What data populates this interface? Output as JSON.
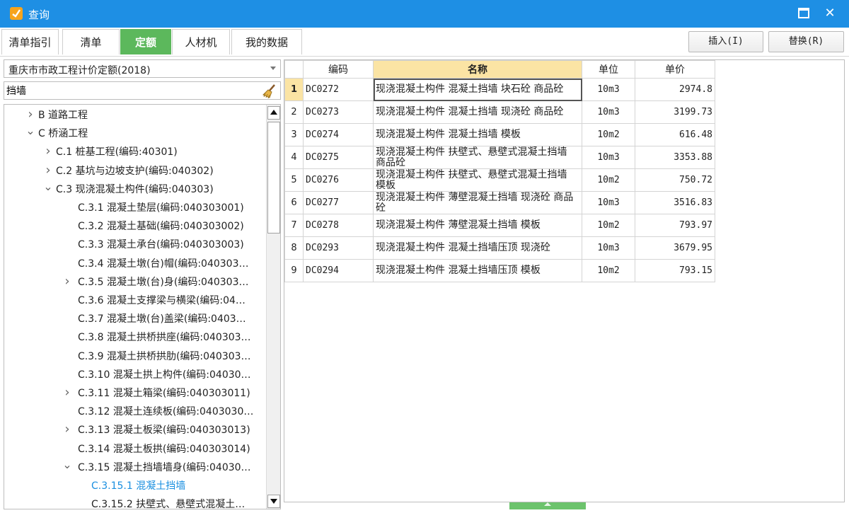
{
  "window": {
    "title": "查询",
    "accent_color": "#1e8fe4",
    "icons": [
      "app-logo-icon",
      "maximize-icon",
      "close-icon"
    ]
  },
  "tabs": [
    {
      "label": "清单指引",
      "active": false
    },
    {
      "label": "清单",
      "active": false
    },
    {
      "label": "定额",
      "active": true
    },
    {
      "label": "人材机",
      "active": false
    },
    {
      "label": "我的数据",
      "active": false
    }
  ],
  "actions": {
    "insert": "插入(I)",
    "replace": "替换(R)"
  },
  "left": {
    "library": "重庆市市政工程计价定额(2018)",
    "search_value": "挡墙",
    "search_icon": "broom-icon",
    "tree": [
      {
        "chevron": "collapsed",
        "label": "B 道路工程"
      },
      {
        "chevron": "expanded",
        "label": "C 桥涵工程"
      },
      {
        "chevron": "collapsed",
        "label": "C.1 桩基工程(编码:40301)"
      },
      {
        "chevron": "collapsed",
        "label": "C.2 基坑与边坡支护(编码:040302)"
      },
      {
        "chevron": "expanded",
        "label": "C.3 现浇混凝土构件(编码:040303)"
      },
      {
        "chevron": "",
        "label": "C.3.1 混凝土垫层(编码:040303001)"
      },
      {
        "chevron": "",
        "label": "C.3.2 混凝土基础(编码:040303002)"
      },
      {
        "chevron": "",
        "label": "C.3.3 混凝土承台(编码:040303003)"
      },
      {
        "chevron": "",
        "label": "C.3.4 混凝土墩(台)帽(编码:040303…"
      },
      {
        "chevron": "collapsed",
        "label": "C.3.5 混凝土墩(台)身(编码:040303…"
      },
      {
        "chevron": "",
        "label": "C.3.6 混凝土支撑梁与横梁(编码:04…"
      },
      {
        "chevron": "",
        "label": "C.3.7 混凝土墩(台)盖梁(编码:0403…"
      },
      {
        "chevron": "",
        "label": "C.3.8 混凝土拱桥拱座(编码:040303…"
      },
      {
        "chevron": "",
        "label": "C.3.9 混凝土拱桥拱肋(编码:040303…"
      },
      {
        "chevron": "",
        "label": "C.3.10 混凝土拱上构件(编码:04030…"
      },
      {
        "chevron": "collapsed",
        "label": "C.3.11 混凝土箱梁(编码:040303011)"
      },
      {
        "chevron": "",
        "label": "C.3.12 混凝土连续板(编码:0403030…"
      },
      {
        "chevron": "collapsed",
        "label": "C.3.13 混凝土板梁(编码:040303013)"
      },
      {
        "chevron": "",
        "label": "C.3.14 混凝土板拱(编码:040303014)"
      },
      {
        "chevron": "expanded",
        "label": "C.3.15 混凝土挡墙墙身(编码:04030…"
      },
      {
        "chevron": "",
        "label": "C.3.15.1 混凝土挡墙",
        "selected": true
      },
      {
        "chevron": "",
        "label": "C.3.15.2 扶壁式、悬壁式混凝土…"
      }
    ]
  },
  "grid": {
    "columns": [
      "编码",
      "名称",
      "单位",
      "单价"
    ],
    "sorted_column": "名称",
    "rows": [
      {
        "no": "1",
        "code": "DC0272",
        "name": "现浇混凝土构件 混凝土挡墙 块石砼 商品砼",
        "unit": "10m3",
        "price": "2974.8"
      },
      {
        "no": "2",
        "code": "DC0273",
        "name": "现浇混凝土构件 混凝土挡墙 现浇砼 商品砼",
        "unit": "10m3",
        "price": "3199.73"
      },
      {
        "no": "3",
        "code": "DC0274",
        "name": "现浇混凝土构件 混凝土挡墙 模板",
        "unit": "10m2",
        "price": "616.48"
      },
      {
        "no": "4",
        "code": "DC0275",
        "name": "现浇混凝土构件 扶壁式、悬壁式混凝土挡墙 商品砼",
        "unit": "10m3",
        "price": "3353.88"
      },
      {
        "no": "5",
        "code": "DC0276",
        "name": "现浇混凝土构件 扶壁式、悬壁式混凝土挡墙 模板",
        "unit": "10m2",
        "price": "750.72"
      },
      {
        "no": "6",
        "code": "DC0277",
        "name": "现浇混凝土构件 薄壁混凝土挡墙 现浇砼 商品砼",
        "unit": "10m3",
        "price": "3516.83"
      },
      {
        "no": "7",
        "code": "DC0278",
        "name": "现浇混凝土构件 薄壁混凝土挡墙 模板",
        "unit": "10m2",
        "price": "793.97"
      },
      {
        "no": "8",
        "code": "DC0293",
        "name": "现浇混凝土构件 混凝土挡墙压顶 现浇砼",
        "unit": "10m3",
        "price": "3679.95"
      },
      {
        "no": "9",
        "code": "DC0294",
        "name": "现浇混凝土构件 混凝土挡墙压顶 模板",
        "unit": "10m2",
        "price": "793.15"
      }
    ],
    "current_row": "1"
  }
}
